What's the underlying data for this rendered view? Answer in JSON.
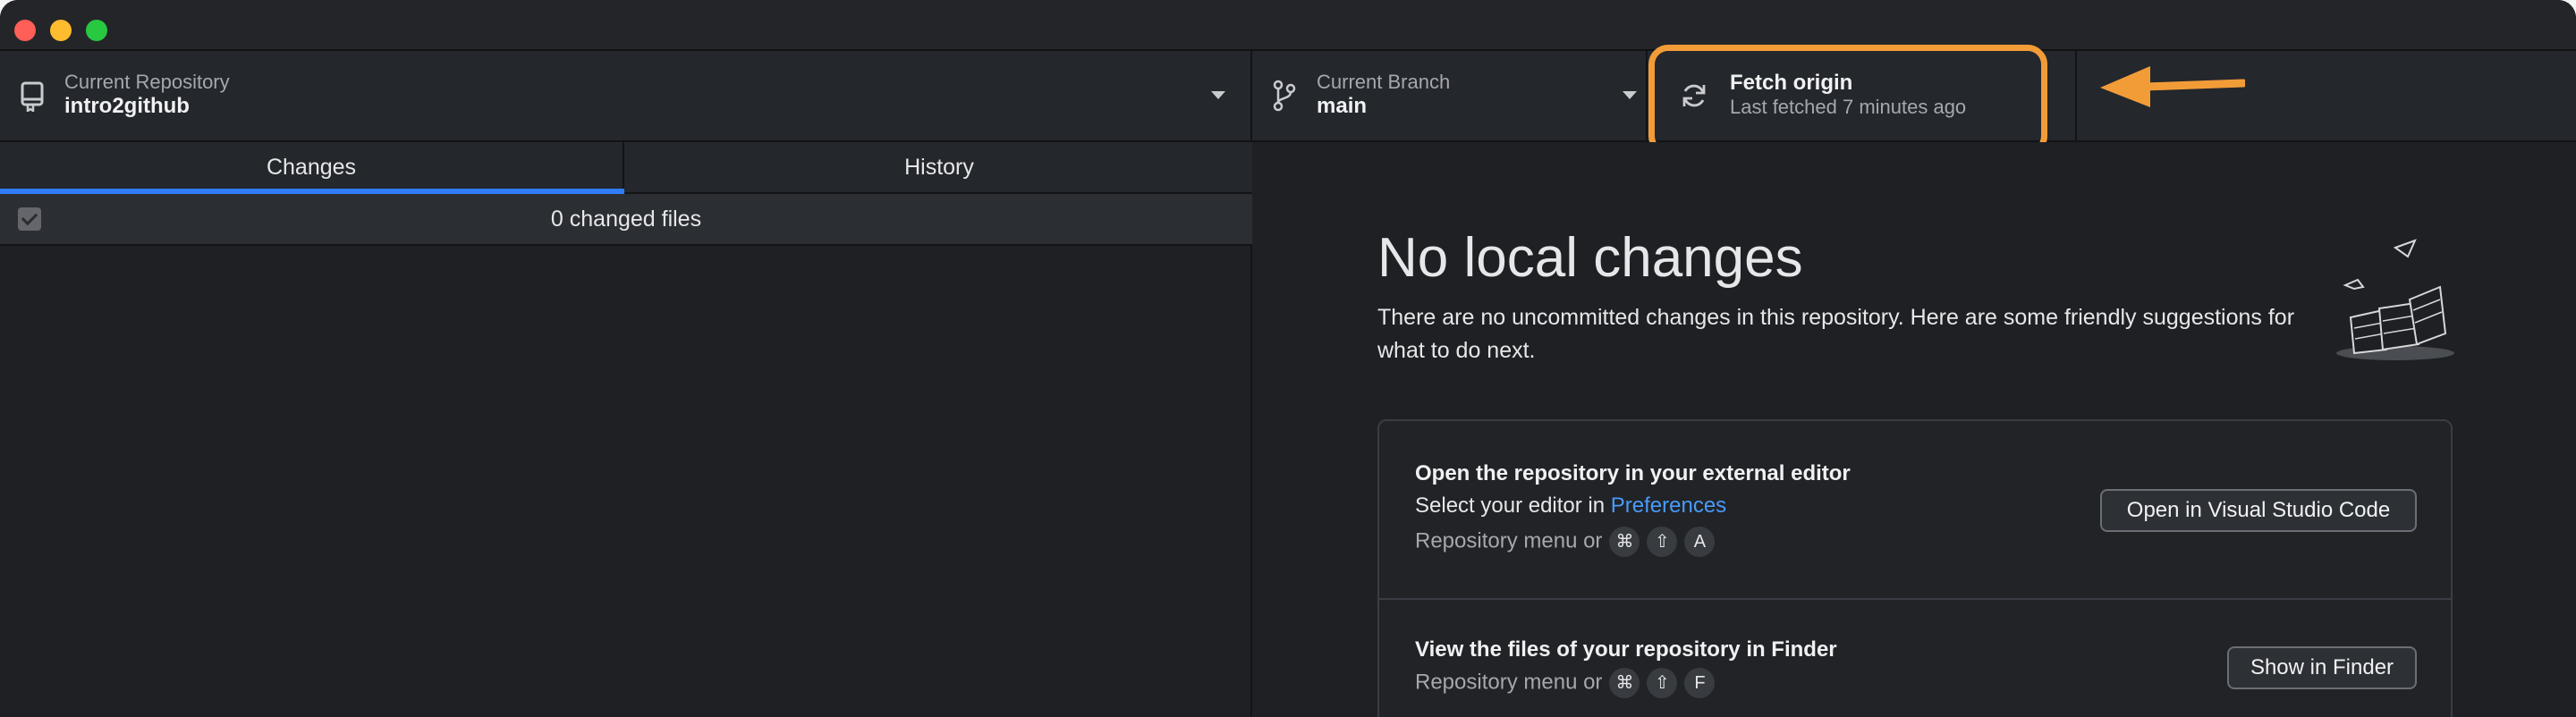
{
  "window": {
    "controls": [
      "close",
      "minimize",
      "zoom"
    ]
  },
  "toolbar": {
    "repository": {
      "label": "Current Repository",
      "value": "intro2github",
      "icon": "repository-icon"
    },
    "branch": {
      "label": "Current Branch",
      "value": "main",
      "icon": "git-branch-icon"
    },
    "fetch": {
      "title": "Fetch origin",
      "subtitle": "Last fetched 7 minutes ago",
      "icon": "sync-icon"
    },
    "annotation": {
      "highlight_color": "#f29c38",
      "arrow": "arrow-left-icon"
    }
  },
  "sidebar": {
    "tabs": [
      {
        "label": "Changes",
        "selected": true
      },
      {
        "label": "History",
        "selected": false
      }
    ],
    "changed_files": "0 changed files"
  },
  "main": {
    "title": "No local changes",
    "description": "There are no uncommitted changes in this repository. Here are some friendly suggestions for what to do next.",
    "suggestions": [
      {
        "title": "Open the repository in your external editor",
        "subtitle_prefix": "Select your editor in ",
        "subtitle_link": "Preferences",
        "hint": "Repository menu or",
        "keys": [
          "⌘",
          "⇧",
          "A"
        ],
        "button": "Open in Visual Studio Code"
      },
      {
        "title": "View the files of your repository in Finder",
        "hint": "Repository menu or",
        "keys": [
          "⌘",
          "⇧",
          "F"
        ],
        "button": "Show in Finder"
      }
    ]
  },
  "colors": {
    "accent": "#2f7ef7",
    "link": "#4a9af8",
    "highlight": "#f29c38",
    "background": "#1e2024"
  }
}
